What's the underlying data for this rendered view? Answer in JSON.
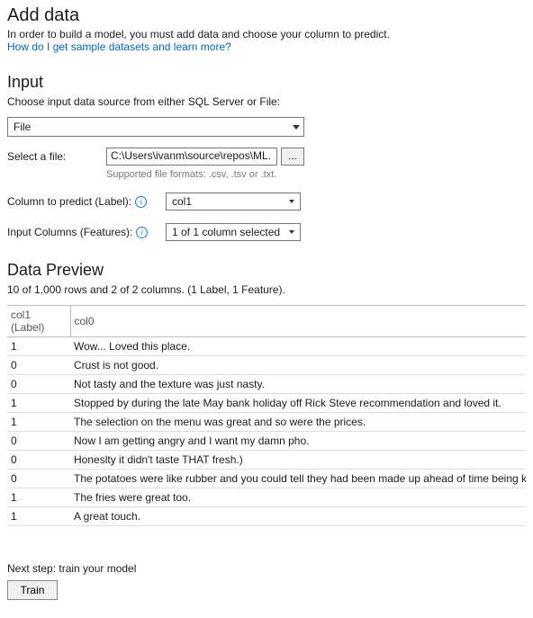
{
  "header": {
    "title": "Add data",
    "description": "In order to build a model, you must add data and choose your column to predict.",
    "help_link": "How do I get sample datasets and learn more?"
  },
  "input_section": {
    "heading": "Input",
    "instruction": "Choose input data source from either SQL Server or File:",
    "source_selected": "File",
    "file_label": "Select a file:",
    "file_path": "C:\\Users\\ivanm\\source\\repos\\ML.",
    "browse_label": "...",
    "supported_hint": "Supported file formats: .csv, .tsv or .txt.",
    "label_field": "Column to predict (Label):",
    "label_selected": "col1",
    "features_field": "Input Columns (Features):",
    "features_selected": "1 of 1 column selected"
  },
  "preview": {
    "heading": "Data Preview",
    "summary": "10 of 1,000 rows and 2 of 2 columns. (1 Label, 1 Feature).",
    "columns": [
      "col1 (Label)",
      "col0"
    ],
    "rows": [
      {
        "label": "1",
        "text": "Wow... Loved this place."
      },
      {
        "label": "0",
        "text": "Crust is not good."
      },
      {
        "label": "0",
        "text": "Not tasty and the texture was just nasty."
      },
      {
        "label": "1",
        "text": "Stopped by during the late May bank holiday off Rick Steve recommendation and loved it."
      },
      {
        "label": "1",
        "text": "The selection on the menu was great and so were the prices."
      },
      {
        "label": "0",
        "text": "Now I am getting angry and I want my damn pho."
      },
      {
        "label": "0",
        "text": "Honeslty it didn't taste THAT fresh.)"
      },
      {
        "label": "0",
        "text": "The potatoes were like rubber and you could tell they had been made up ahead of time being kept under a warmer"
      },
      {
        "label": "1",
        "text": "The fries were great too."
      },
      {
        "label": "1",
        "text": "A great touch."
      }
    ]
  },
  "footer": {
    "next_step": "Next step: train your model",
    "train_label": "Train"
  }
}
